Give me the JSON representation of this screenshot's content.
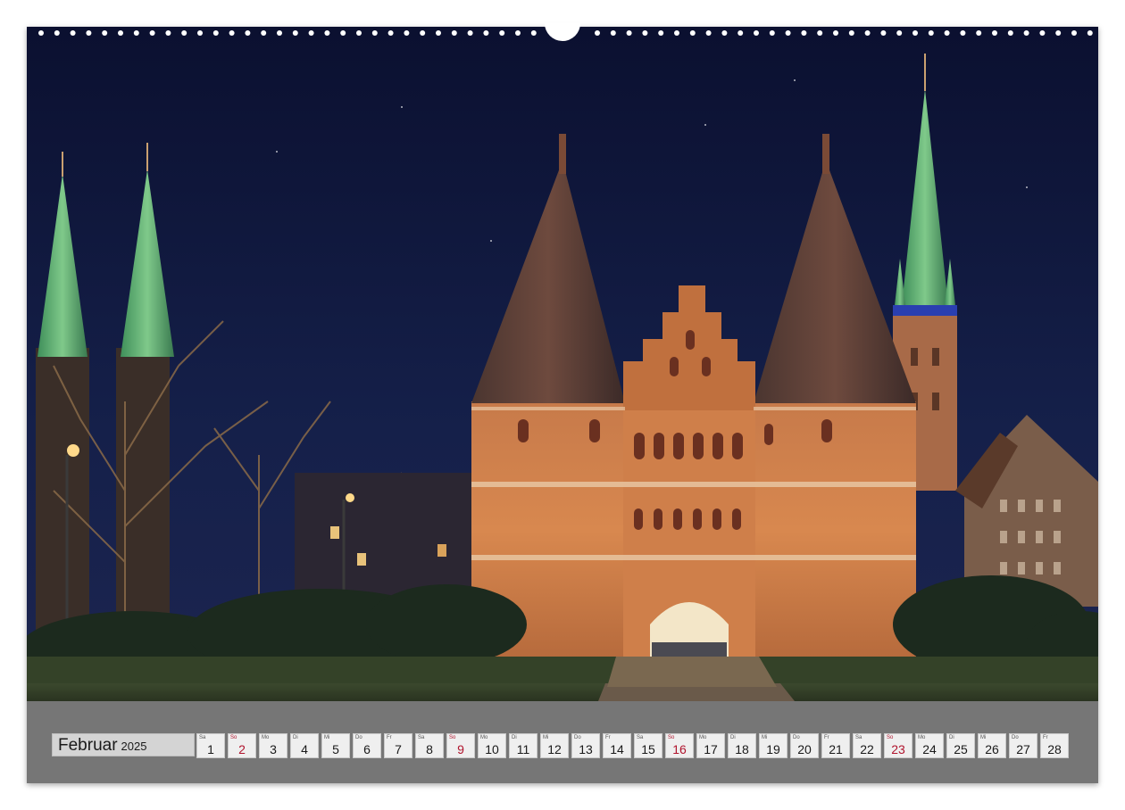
{
  "calendar": {
    "month": "Februar",
    "year": "2025",
    "days": [
      {
        "weekday": "Sa",
        "day": "1",
        "sunday": false
      },
      {
        "weekday": "So",
        "day": "2",
        "sunday": true
      },
      {
        "weekday": "Mo",
        "day": "3",
        "sunday": false
      },
      {
        "weekday": "Di",
        "day": "4",
        "sunday": false
      },
      {
        "weekday": "Mi",
        "day": "5",
        "sunday": false
      },
      {
        "weekday": "Do",
        "day": "6",
        "sunday": false
      },
      {
        "weekday": "Fr",
        "day": "7",
        "sunday": false
      },
      {
        "weekday": "Sa",
        "day": "8",
        "sunday": false
      },
      {
        "weekday": "So",
        "day": "9",
        "sunday": true
      },
      {
        "weekday": "Mo",
        "day": "10",
        "sunday": false
      },
      {
        "weekday": "Di",
        "day": "11",
        "sunday": false
      },
      {
        "weekday": "Mi",
        "day": "12",
        "sunday": false
      },
      {
        "weekday": "Do",
        "day": "13",
        "sunday": false
      },
      {
        "weekday": "Fr",
        "day": "14",
        "sunday": false
      },
      {
        "weekday": "Sa",
        "day": "15",
        "sunday": false
      },
      {
        "weekday": "So",
        "day": "16",
        "sunday": true
      },
      {
        "weekday": "Mo",
        "day": "17",
        "sunday": false
      },
      {
        "weekday": "Di",
        "day": "18",
        "sunday": false
      },
      {
        "weekday": "Mi",
        "day": "19",
        "sunday": false
      },
      {
        "weekday": "Do",
        "day": "20",
        "sunday": false
      },
      {
        "weekday": "Fr",
        "day": "21",
        "sunday": false
      },
      {
        "weekday": "Sa",
        "day": "22",
        "sunday": false
      },
      {
        "weekday": "So",
        "day": "23",
        "sunday": true
      },
      {
        "weekday": "Mo",
        "day": "24",
        "sunday": false
      },
      {
        "weekday": "Di",
        "day": "25",
        "sunday": false
      },
      {
        "weekday": "Mi",
        "day": "26",
        "sunday": false
      },
      {
        "weekday": "Do",
        "day": "27",
        "sunday": false
      },
      {
        "weekday": "Fr",
        "day": "28",
        "sunday": false
      }
    ]
  },
  "colors": {
    "sunday": "#b0142d",
    "bar": "#767676",
    "sky": "#10183a"
  }
}
